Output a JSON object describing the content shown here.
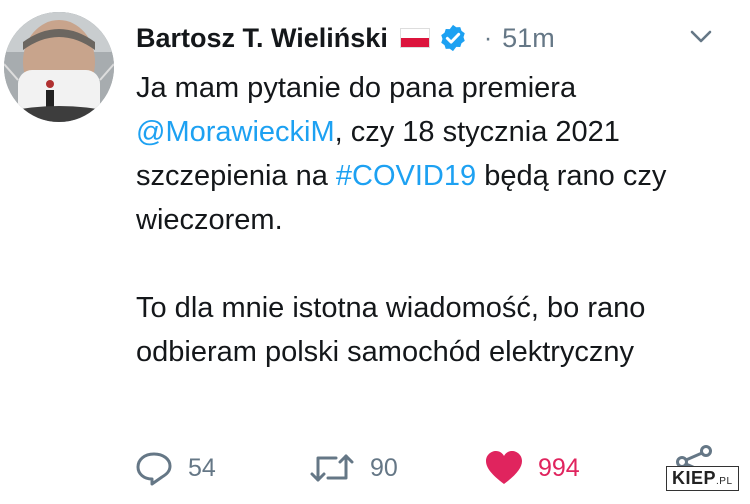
{
  "tweet": {
    "author_name": "Bartosz T. Wieliński",
    "timestamp": "51m",
    "separator": "·",
    "text": {
      "p1_before_mention": "Ja mam pytanie do pana premiera ",
      "mention": "@MorawieckiM",
      "p1_after_mention": ", czy 18 stycznia 2021 szczepienia na ",
      "hashtag": "#COVID19",
      "p1_after_hashtag": " będą rano czy wieczorem.",
      "p2": "To dla mnie istotna wiadomość, bo rano odbieram polski samochód elektryczny"
    },
    "actions": {
      "reply_count": "54",
      "retweet_count": "90",
      "like_count": "994"
    }
  },
  "watermark": {
    "brand": "KIEP",
    "suffix": ".PL"
  },
  "icons": {
    "flag": "poland-flag-icon",
    "verified": "verified-badge-icon",
    "caret": "chevron-down-icon",
    "reply": "reply-icon",
    "retweet": "retweet-icon",
    "like": "heart-icon",
    "share": "share-icon"
  },
  "colors": {
    "link": "#1da1f2",
    "verified": "#1da1f2",
    "like_active": "#e0245e",
    "muted": "#657786"
  }
}
